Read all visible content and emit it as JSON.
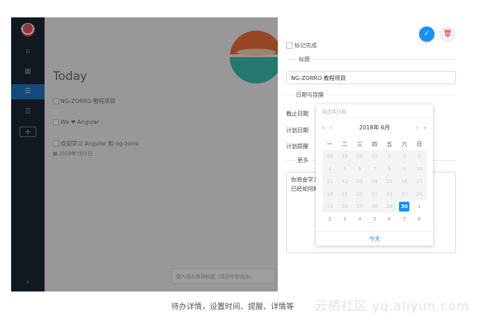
{
  "sidebar": {
    "items": [
      {
        "icon": "home-icon",
        "glyph": "⌂"
      },
      {
        "icon": "calendar-icon",
        "glyph": "▦"
      },
      {
        "icon": "list-icon",
        "glyph": "☰"
      },
      {
        "icon": "list-icon",
        "glyph": "☰"
      }
    ],
    "add_label": "+",
    "collapse_glyph": "›"
  },
  "main": {
    "title": "Today",
    "todos": [
      {
        "text": "NG-ZORRO 教程项目"
      },
      {
        "text": "We ❤ Angular"
      },
      {
        "text": "欢迎学习 Angular 和 ng-zorro"
      }
    ],
    "todo_date": "2018年7月1日",
    "add_placeholder": "键入待办事项标题（项目中有待办）"
  },
  "drawer": {
    "confirm_glyph": "✓",
    "delete_glyph": "🗑",
    "mark_done": "标记完成",
    "title_section": "标题",
    "title_value": "NG-ZORRO 教程项目",
    "date_section": "日期与提醒",
    "deadline_label": "截止日期",
    "deadline_placeholder": "请选择日期",
    "plan_date_label": "计划日期",
    "plan_remind_label": "计划提醒",
    "more_section": "更多",
    "notes_line1": "你将会学习",
    "notes_line2": "已经如何构"
  },
  "calendar": {
    "header": "2018年 6月",
    "prev_year": "«",
    "prev_month": "‹",
    "next_month": "›",
    "next_year": "»",
    "weekdays": [
      "一",
      "二",
      "三",
      "四",
      "五",
      "六",
      "日"
    ],
    "weeks": [
      [
        "28",
        "29",
        "30",
        "31",
        "1",
        "2",
        "3"
      ],
      [
        "4",
        "5",
        "6",
        "7",
        "8",
        "9",
        "10"
      ],
      [
        "11",
        "12",
        "13",
        "14",
        "15",
        "16",
        "17"
      ],
      [
        "18",
        "19",
        "20",
        "21",
        "22",
        "23",
        "24"
      ],
      [
        "25",
        "26",
        "27",
        "28",
        "29",
        "30",
        "1"
      ],
      [
        "2",
        "3",
        "4",
        "5",
        "6",
        "7",
        "8"
      ]
    ],
    "selected": "30",
    "today_label": "今天"
  },
  "caption": {
    "text": "待办详情，设置时间、提醒、详情等",
    "watermark": "云栖社区 yq.aliyun.com"
  },
  "colors": {
    "accent": "#1890ff",
    "sidebar": "#1b2736",
    "danger": "#f5222d"
  }
}
